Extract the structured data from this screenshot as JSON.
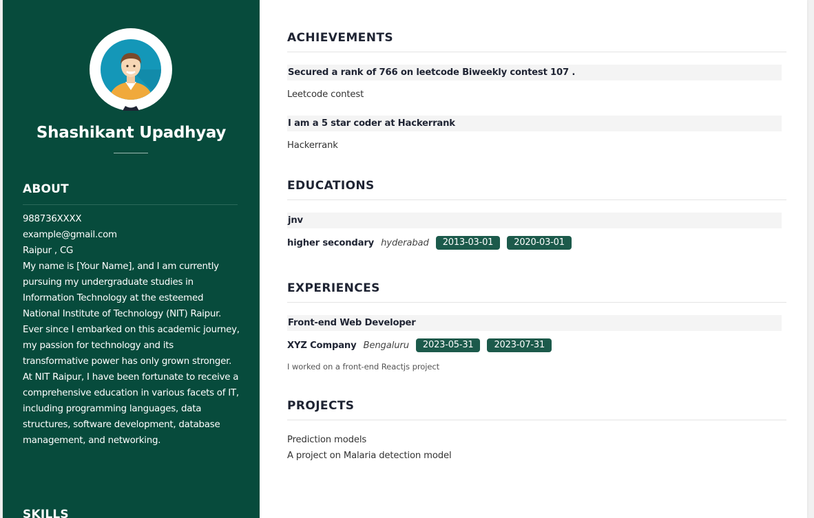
{
  "profile": {
    "name": "Shashikant Upadhyay",
    "avatar_icon": "user-avatar-icon"
  },
  "about": {
    "heading": "ABOUT",
    "phone": "988736XXXX",
    "email": "example@gmail.com",
    "location": "Raipur , CG",
    "description": "My name is [Your Name], and I am currently pursuing my undergraduate studies in Information Technology at the esteemed National Institute of Technology (NIT) Raipur. Ever since I embarked on this academic journey, my passion for technology and its transformative power has only grown stronger. At NIT Raipur, I have been fortunate to receive a comprehensive education in various facets of IT, including programming languages, data structures, software development, database management, and networking."
  },
  "skills": {
    "heading": "SKILLS"
  },
  "achievements": {
    "heading": "ACHIEVEMENTS",
    "items": [
      {
        "title": "Secured a rank of 766 on leetcode Biweekly contest 107 .",
        "subtitle": "Leetcode contest"
      },
      {
        "title": "I am a 5 star coder at Hackerrank",
        "subtitle": "Hackerrank"
      }
    ]
  },
  "educations": {
    "heading": "EDUCATIONS",
    "items": [
      {
        "title": "jnv",
        "degree": "higher secondary",
        "location": "hyderabad",
        "start": "2013-03-01",
        "end": "2020-03-01"
      }
    ]
  },
  "experiences": {
    "heading": "EXPERIENCES",
    "items": [
      {
        "title": "Front-end Web Developer",
        "company": "XYZ Company",
        "location": "Bengaluru",
        "start": "2023-05-31",
        "end": "2023-07-31",
        "description": "I worked on a front-end Reactjs project"
      }
    ]
  },
  "projects": {
    "heading": "PROJECTS",
    "items": [
      {
        "title": "Prediction models",
        "description": "A project on Malaria detection model"
      }
    ]
  },
  "colors": {
    "sidebar": "#074b3c",
    "tag": "#1c5a4b",
    "avatar_bg": "#1497b8",
    "shirt": "#f0a93b"
  }
}
